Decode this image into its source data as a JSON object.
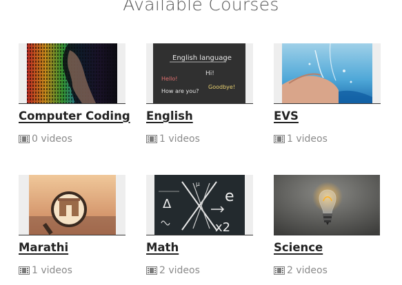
{
  "header": {
    "title": "Available Courses"
  },
  "courses": [
    {
      "title": "Computer Coding",
      "videos": "0 videos",
      "image": "woman-face-with-binary-code-overlay"
    },
    {
      "title": "English",
      "videos": "1 videos",
      "image": "chalkboard-english-language-greetings"
    },
    {
      "title": "EVS",
      "videos": "1 videos",
      "image": "hands-catching-water-splash"
    },
    {
      "title": "Marathi",
      "videos": "1 videos",
      "image": "gateway-of-india-through-magnifying-lens"
    },
    {
      "title": "Math",
      "videos": "2 videos",
      "image": "chalkboard-with-math-formulas"
    },
    {
      "title": "Science",
      "videos": "2 videos",
      "image": "glowing-light-bulb"
    }
  ],
  "chalkboard_texts": {
    "english": {
      "heading": "English language",
      "hi": "Hi!",
      "hello": "Hello!",
      "how": "How are you?",
      "goodbye": "Goodbye!"
    },
    "math": {
      "e": "e",
      "delta": "Δ",
      "x2": "x2",
      "mu": "μ"
    }
  },
  "colors": {
    "title": "#555555",
    "course_title": "#222222",
    "meta_text": "#8a8a8a",
    "thumb_placeholder": "#eeeeee"
  },
  "icons": {
    "video_count": "film-icon"
  }
}
